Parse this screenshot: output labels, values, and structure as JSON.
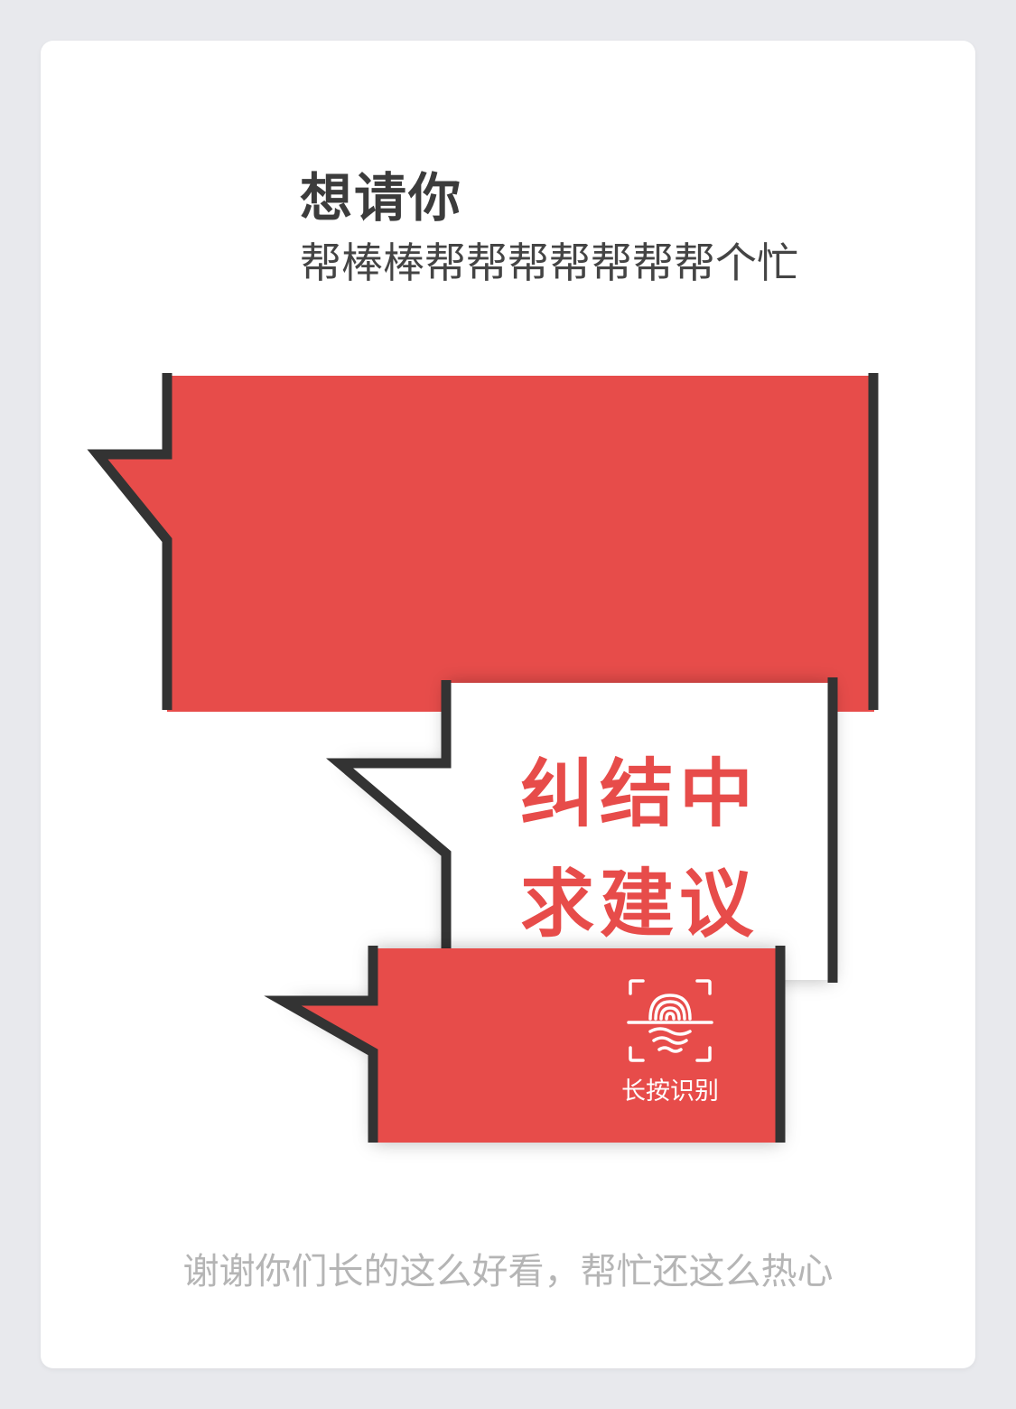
{
  "header": {
    "title": "想请你",
    "subtitle": "帮棒棒帮帮帮帮帮帮帮个忙"
  },
  "bubble": {
    "line1": "纠结中",
    "line2": "求建议"
  },
  "scan": {
    "icon": "fingerprint-icon",
    "label": "长按识别"
  },
  "footer": {
    "text": "谢谢你们长的这么好看，帮忙还这么热心"
  },
  "colors": {
    "accent_red": "#e74c4a",
    "outline": "#333333",
    "background": "#e8e9ed",
    "card": "#ffffff"
  }
}
